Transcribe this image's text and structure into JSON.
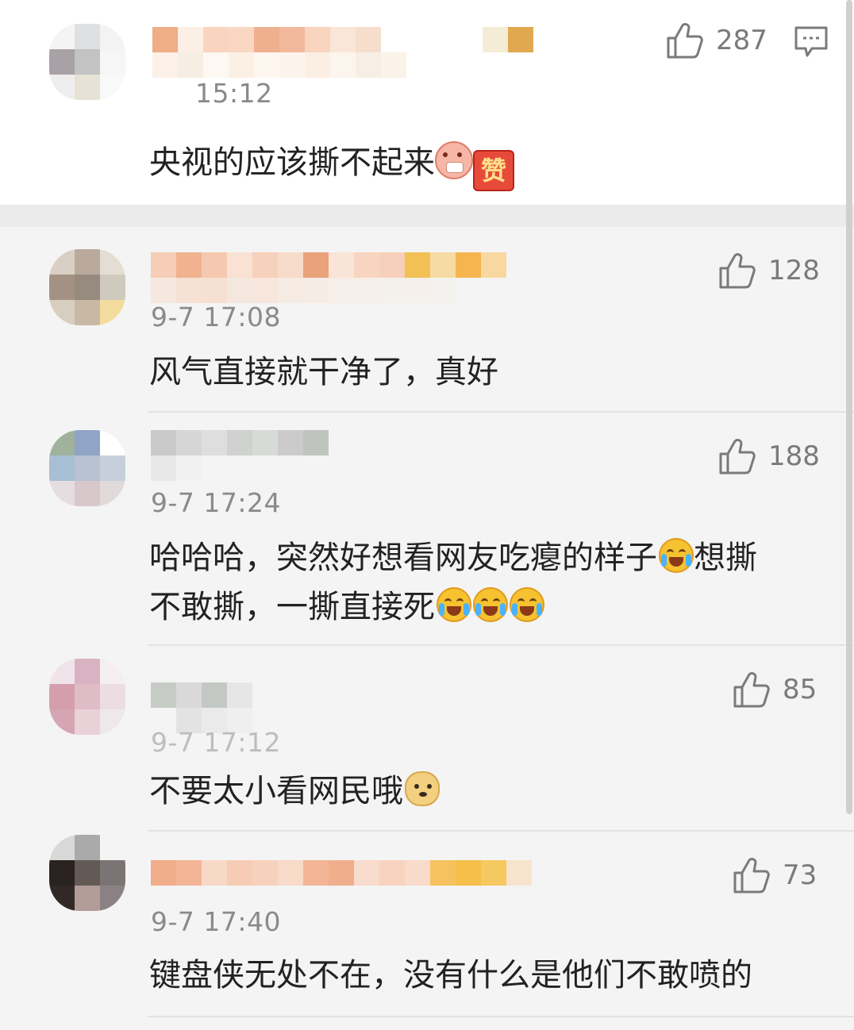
{
  "main_comment": {
    "time": "15:12",
    "likes": "287",
    "text": "央视的应该撕不起来",
    "emoji_1": "dog-fan-emoji",
    "emoji_2_label": "赞"
  },
  "replies": [
    {
      "time": "9-7 17:08",
      "likes": "128",
      "text": "风气直接就干净了，真好",
      "emojis": []
    },
    {
      "time": "9-7 17:24",
      "likes": "188",
      "text_line1": "哈哈哈，突然好想看网友吃瘪的样子",
      "text_line1_tail": "想撕",
      "text_line2": "不敢撕，一撕直接死",
      "emojis": [
        "laugh-cry-emoji"
      ]
    },
    {
      "time": "9-7 17:12",
      "likes": "85",
      "text": "不要太小看网民哦",
      "emojis": [
        "doge-emoji"
      ]
    },
    {
      "time": "9-7 17:40",
      "likes": "73",
      "text": "键盘侠无处不在，没有什么是他们不敢喷的",
      "emojis": []
    }
  ],
  "colors": {
    "page_bg": "#f4f4f4",
    "main_bg": "#ffffff",
    "text": "#222222",
    "meta": "#8a8a8a"
  }
}
